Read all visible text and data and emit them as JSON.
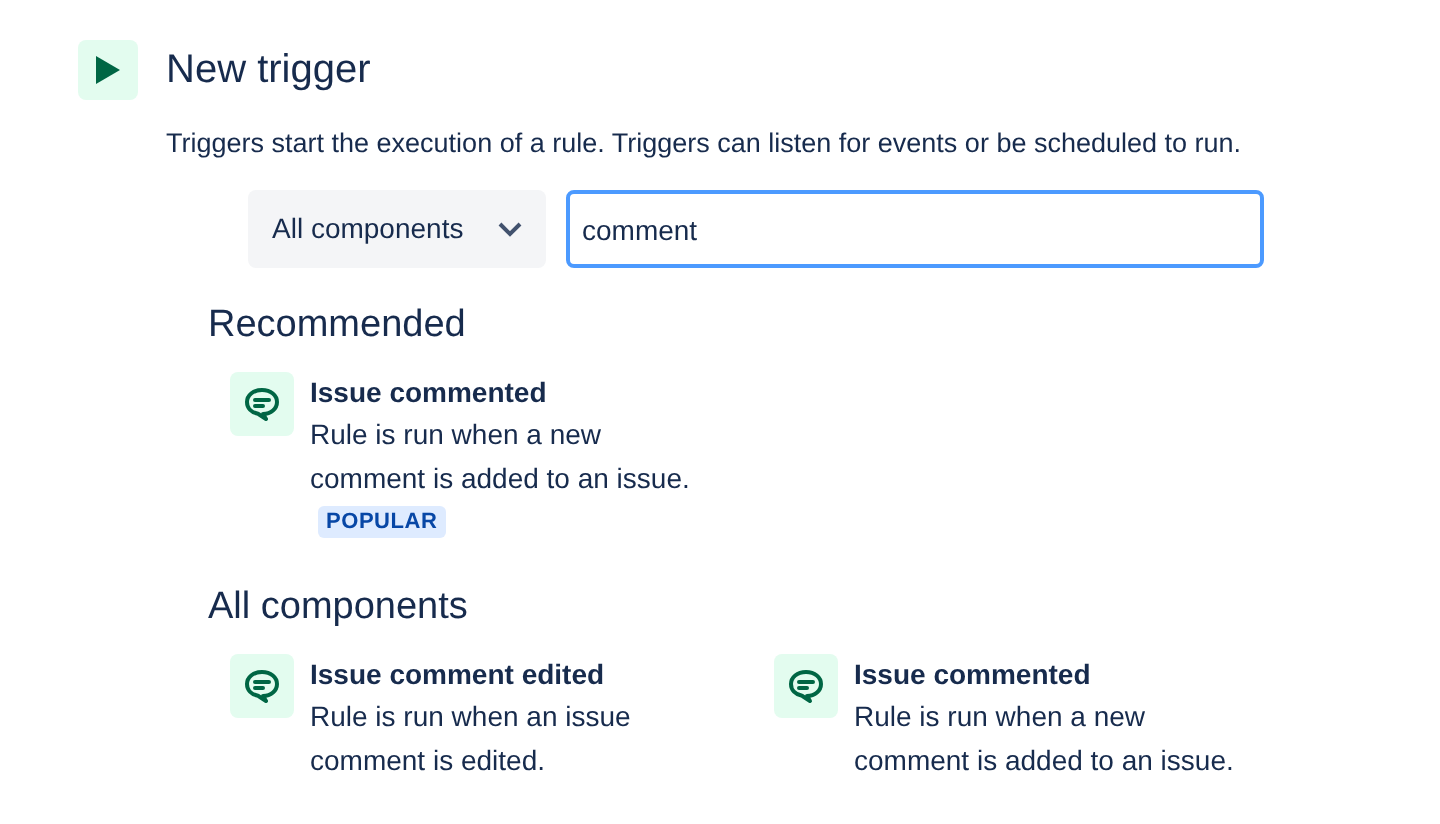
{
  "header": {
    "title": "New trigger",
    "description": "Triggers start the execution of a rule. Triggers can listen for events or be scheduled to run."
  },
  "filter": {
    "dropdown": "All components",
    "search": {
      "value": "comment",
      "focused": true
    }
  },
  "sections": [
    {
      "heading": "Recommended",
      "items": [
        {
          "title": "Issue commented",
          "description": "Rule is run when a new comment is added to an issue.",
          "badge": "POPULAR"
        }
      ]
    },
    {
      "heading": "All components",
      "items": [
        {
          "title": "Issue comment edited",
          "description": "Rule is run when an issue comment is edited."
        },
        {
          "title": "Issue commented",
          "description": "Rule is run when a new comment is added to an issue."
        }
      ]
    }
  ]
}
